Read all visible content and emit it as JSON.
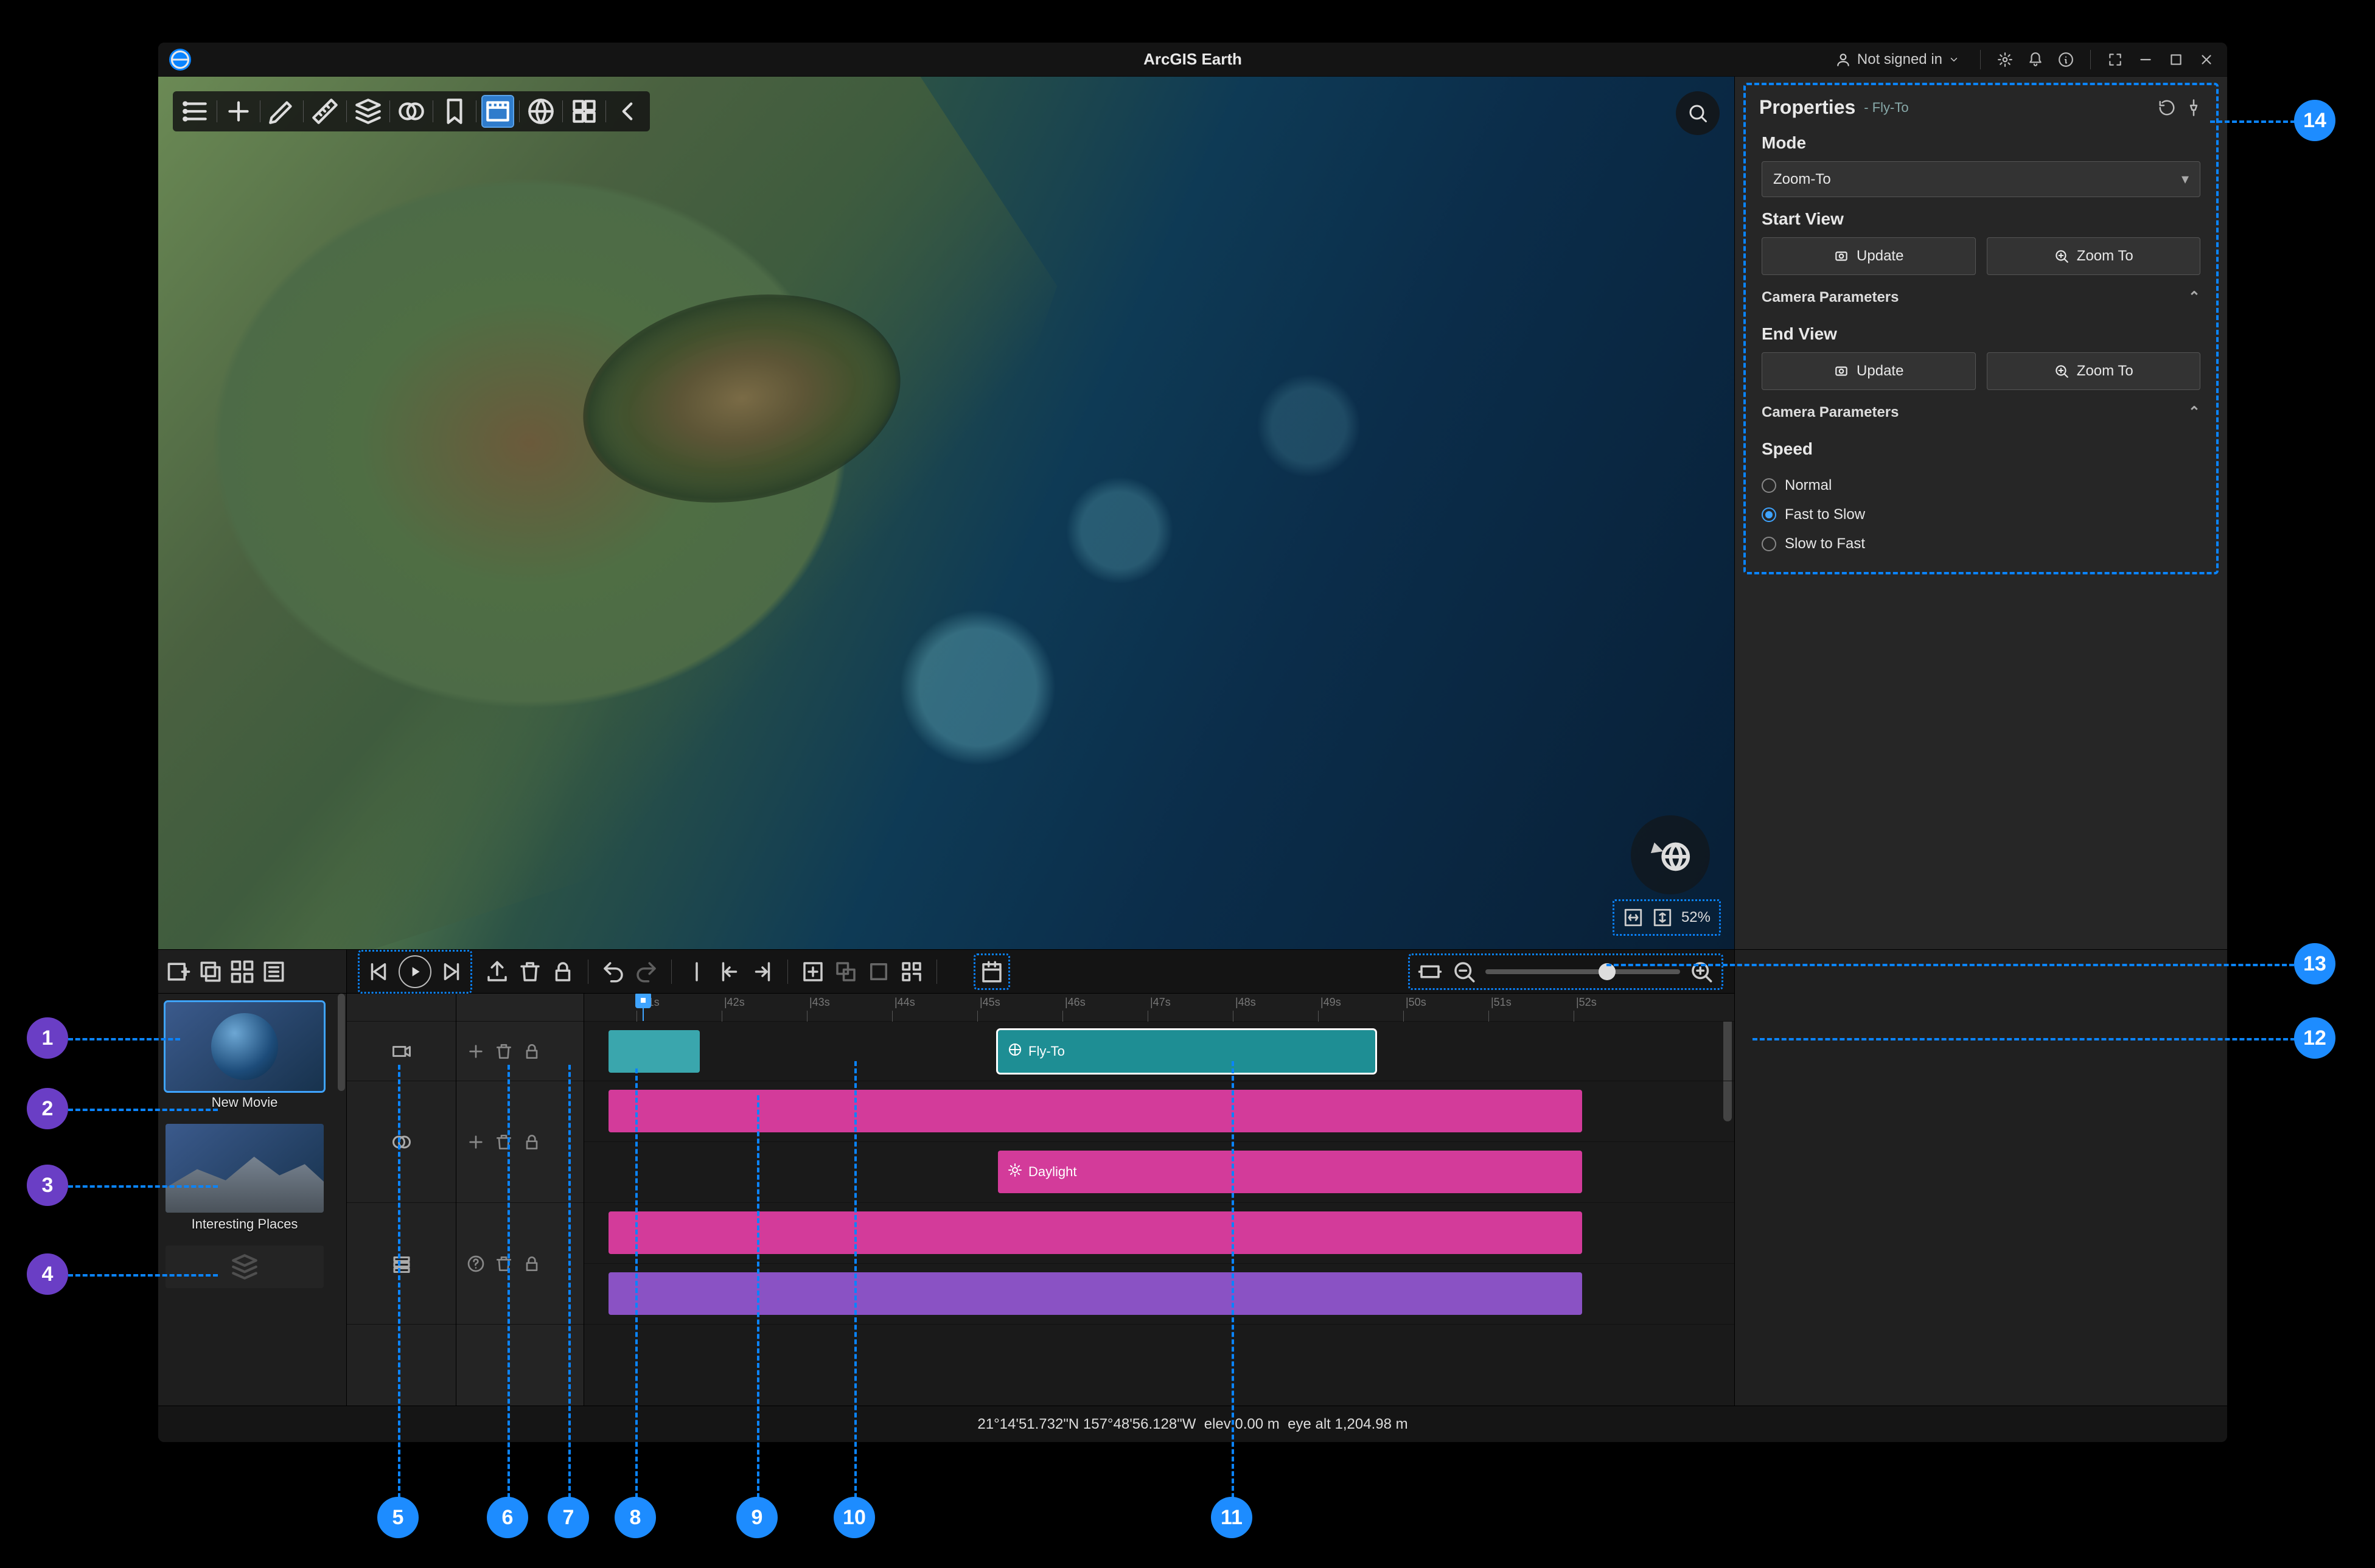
{
  "app": {
    "title": "ArcGIS Earth"
  },
  "titlebar": {
    "signin_label": "Not signed in"
  },
  "properties": {
    "title": "Properties",
    "subtitle": "Fly-To",
    "mode_label": "Mode",
    "mode_value": "Zoom-To",
    "start_view_label": "Start View",
    "update_label": "Update",
    "zoomto_label": "Zoom To",
    "camera_params_label": "Camera Parameters",
    "end_view_label": "End View",
    "speed_label": "Speed",
    "speed_options": {
      "normal": "Normal",
      "fast_slow": "Fast to Slow",
      "slow_fast": "Slow to Fast"
    }
  },
  "scale": {
    "percent": "52%"
  },
  "movies": {
    "new_movie": "New Movie",
    "interesting_places": "Interesting Places"
  },
  "timeline": {
    "ticks": [
      "|41s",
      "|42s",
      "|43s",
      "|44s",
      "|45s",
      "|46s",
      "|47s",
      "|48s",
      "|49s",
      "|50s",
      "|51s",
      "|52s"
    ],
    "flyto_label": "Fly-To",
    "daylight_label": "Daylight"
  },
  "status": {
    "lat": "21°14'51.732\"N",
    "lon": "157°48'56.128\"W",
    "elev": "elev 0.00 m",
    "eye": "eye alt 1,204.98 m"
  },
  "callouts": {
    "c1": "1",
    "c2": "2",
    "c3": "3",
    "c4": "4",
    "c5": "5",
    "c6": "6",
    "c7": "7",
    "c8": "8",
    "c9": "9",
    "c10": "10",
    "c11": "11",
    "c12": "12",
    "c13": "13",
    "c14": "14"
  }
}
